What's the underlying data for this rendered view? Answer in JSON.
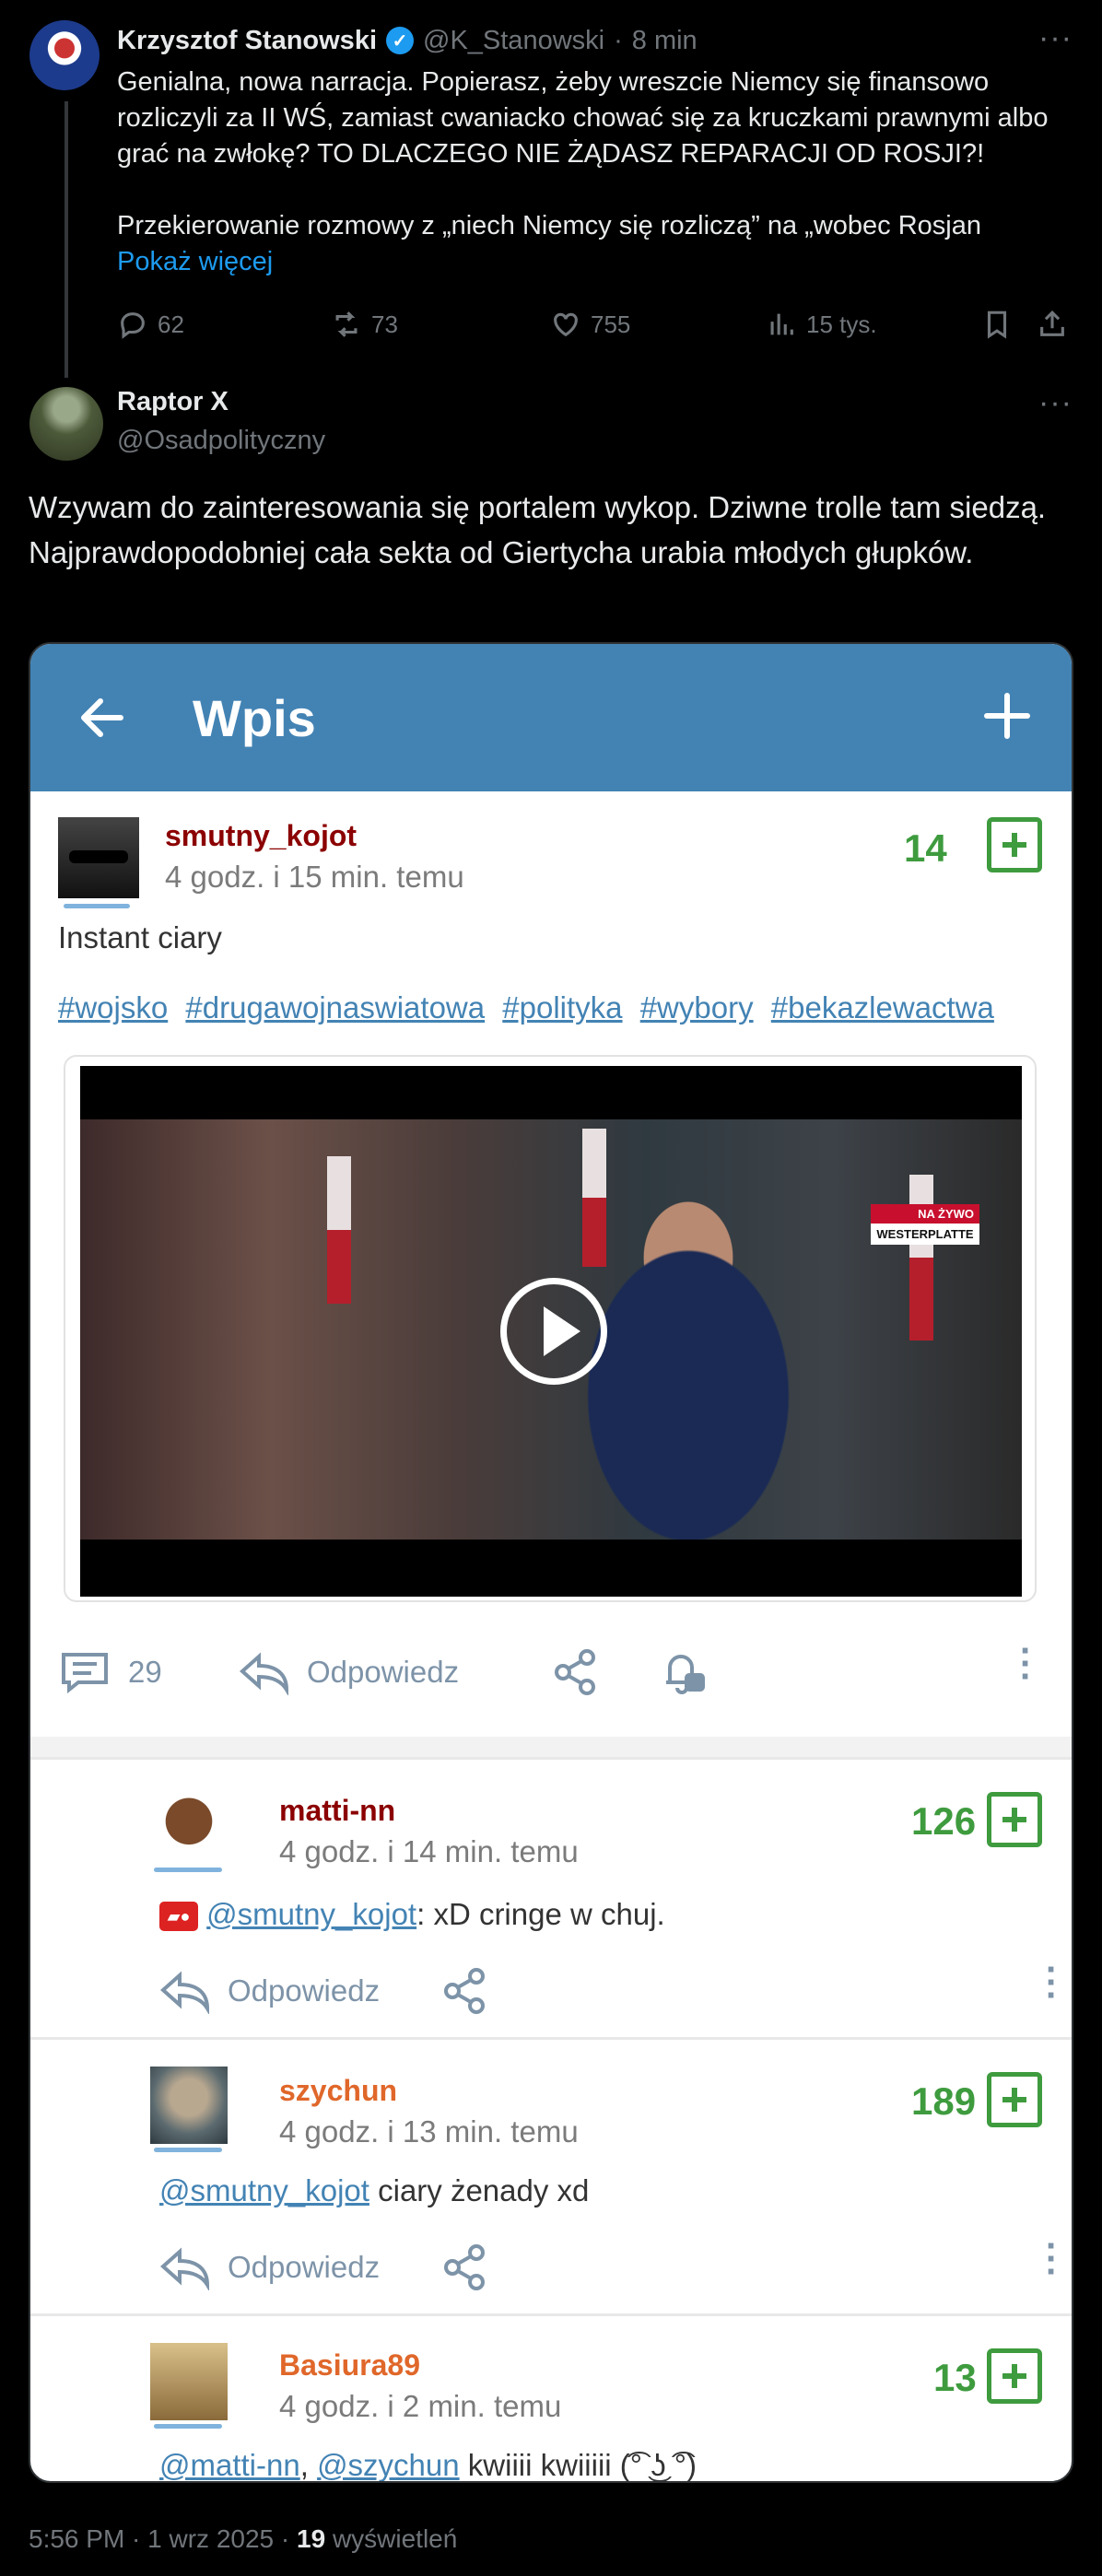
{
  "parent_tweet": {
    "author_name": "Krzysztof Stanowski",
    "handle": "@K_Stanowski",
    "separator": "·",
    "time": "8 min",
    "text_p1": "Genialna, nowa narracja. Popierasz, żeby wreszcie Niemcy się finansowo rozliczyli za II WŚ, zamiast cwaniacko chować się za kruczkami prawnymi albo grać na zwłokę? TO DLACZEGO NIE ŻĄDASZ REPARACJI OD ROSJI?!",
    "text_p2": "Przekierowanie rozmowy z „niech Niemcy się rozliczą” na „wobec Rosjan",
    "show_more": "Pokaż więcej",
    "stats": {
      "replies": "62",
      "reposts": "73",
      "likes": "755",
      "views": "15 tys."
    }
  },
  "reply_tweet": {
    "author_name": "Raptor X",
    "handle": "@Osadpolityczny",
    "text": "Wzywam do zainteresowania się portalem wykop. Dziwne trolle tam siedzą. Najprawdopodobniej cała sekta od Giertycha urabia młodych głupków."
  },
  "embedded_app": {
    "title": "Wpis",
    "entry": {
      "username": "smutny_kojot",
      "time": "4 godz. i 15 min. temu",
      "score": "14",
      "body": "Instant ciary",
      "tags": [
        "#wojsko",
        "#drugawojnaswiatowa",
        "#polityka",
        "#wybory",
        "#bekazlewactwa"
      ],
      "video_badge_top": "NA ŻYWO",
      "video_badge_bottom": "WESTERPLATTE",
      "comment_count": "29",
      "reply_label": "Odpowiedz"
    },
    "comments": [
      {
        "username": "matti-nn",
        "name_color": "#8b0000",
        "time": "4 godz. i 14 min. temu",
        "score": "126",
        "mention": "@smutny_kojot",
        "text": ":  xD cringe w chuj.",
        "reply_label": "Odpowiedz"
      },
      {
        "username": "szychun",
        "name_color": "#e0672a",
        "time": "4 godz. i 13 min. temu",
        "score": "189",
        "mention": "@smutny_kojot",
        "text": " ciary żenady xd",
        "reply_label": "Odpowiedz"
      },
      {
        "username": "Basiura89",
        "name_color": "#e0672a",
        "time": "4 godz. i 2 min. temu",
        "score": "13",
        "mention": "@matti-nn",
        "mention2": "@szychun",
        "text": "  kwiiii kwiiiii (͡° ͜ʖ ͡°)"
      }
    ]
  },
  "footer": {
    "time": "5:56 PM · 1 wrz 2025 · ",
    "views_count": "19",
    "views_label": " wyświetleń"
  }
}
